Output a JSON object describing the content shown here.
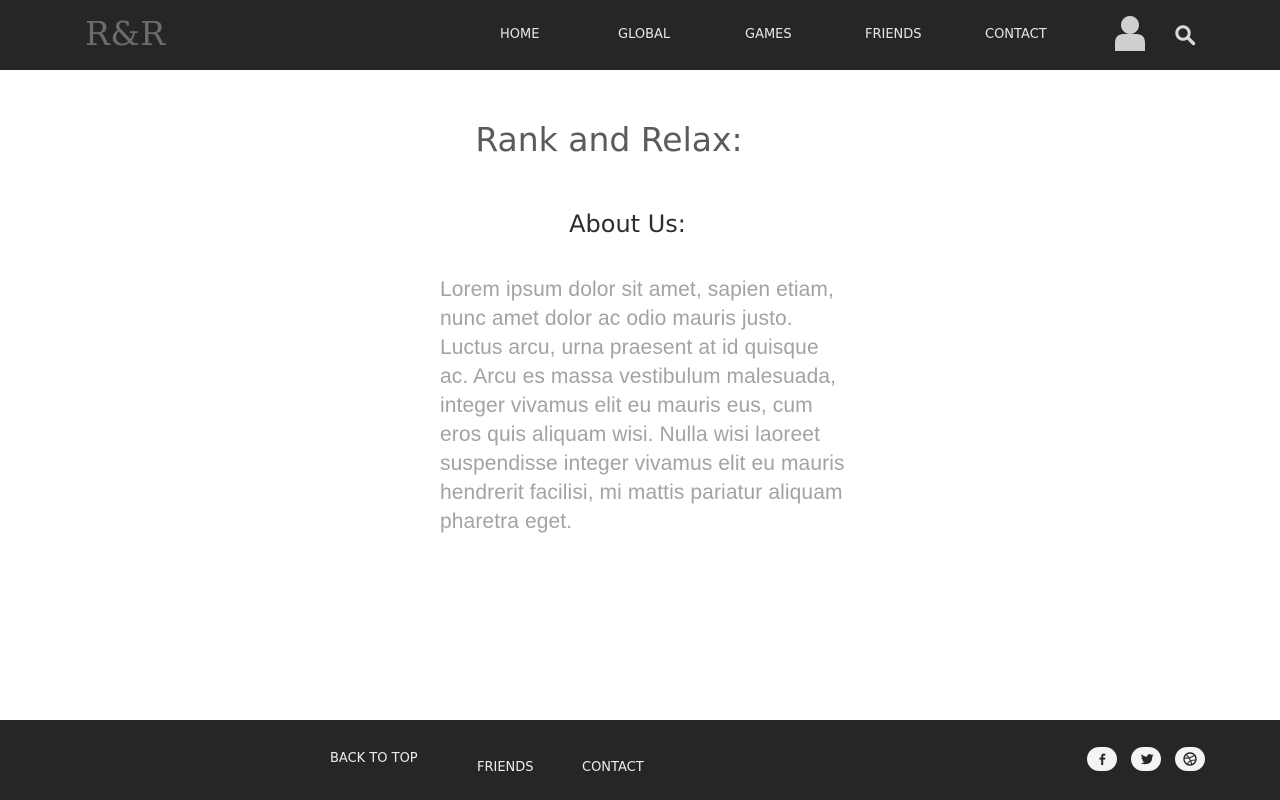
{
  "header": {
    "logo": "R&R",
    "nav": {
      "home": "HOME",
      "global": "GLOBAL",
      "games": "GAMES",
      "friends": "FRIENDS",
      "contact": "CONTACT"
    },
    "icons": {
      "user": "user-icon",
      "search": "search-icon"
    }
  },
  "main": {
    "title": "Rank and Relax:",
    "section_heading": "About Us:",
    "about_text": "Lorem ipsum dolor sit amet, sapien etiam, nunc amet dolor ac odio mauris justo. Luctus arcu, urna praesent at id quisque ac. Arcu es massa vestibulum malesuada, integer vivamus elit eu mauris eus, cum eros quis aliquam wisi. Nulla wisi laoreet suspendisse integer vivamus elit eu mauris hendrerit facilisi, mi mattis pariatur aliquam pharetra eget."
  },
  "footer": {
    "links": {
      "back_to_top": "BACK TO TOP",
      "friends": "FRIENDS",
      "contact": "CONTACT"
    },
    "social_icons": [
      "facebook-icon",
      "twitter-icon",
      "dribbble-icon"
    ]
  },
  "colors": {
    "bar_background": "#262626",
    "page_background": "#ffffff",
    "title": "#5b5b5b",
    "heading": "#2d2d2d",
    "body_text": "#a3a3a3",
    "icon_fill": "#cfcfcf"
  }
}
